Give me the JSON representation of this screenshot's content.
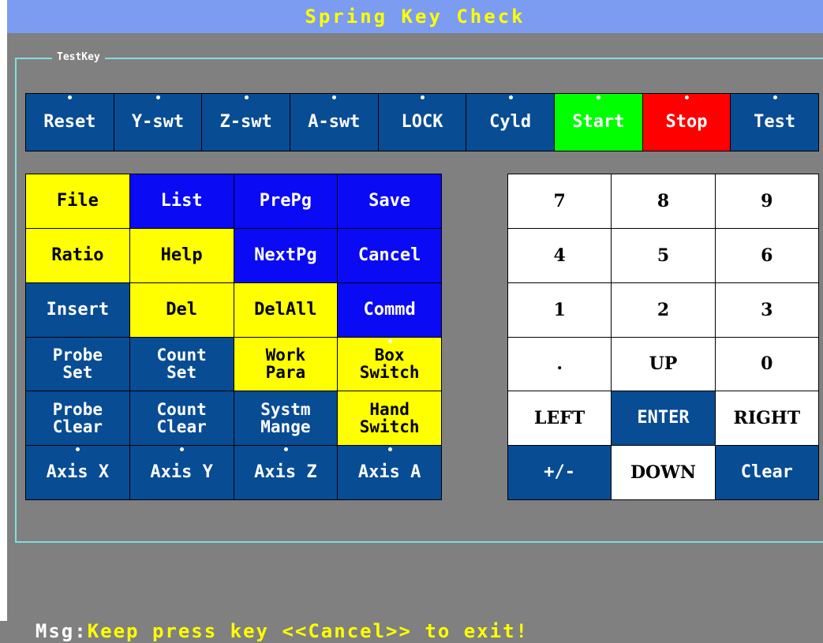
{
  "title": "Spring Key Check",
  "group_label": "TestKey",
  "colors": {
    "navy": "#084c94",
    "blue": "#0a0af5",
    "yellow": "#ffff00",
    "green": "#00ff00",
    "red": "#ff0000",
    "white": "#ffffff"
  },
  "top_row": [
    {
      "label": "Reset",
      "color": "navy",
      "indicator": true
    },
    {
      "label": "Y-swt",
      "color": "navy",
      "indicator": true
    },
    {
      "label": "Z-swt",
      "color": "navy",
      "indicator": true
    },
    {
      "label": "A-swt",
      "color": "navy",
      "indicator": true
    },
    {
      "label": "LOCK",
      "color": "navy",
      "indicator": true
    },
    {
      "label": "Cyld",
      "color": "navy",
      "indicator": true
    },
    {
      "label": "Start",
      "color": "green",
      "indicator": true
    },
    {
      "label": "Stop",
      "color": "red",
      "indicator": true
    },
    {
      "label": "Test",
      "color": "navy",
      "indicator": true
    }
  ],
  "function_grid": [
    {
      "label": "File",
      "color": "yellow"
    },
    {
      "label": "List",
      "color": "blue"
    },
    {
      "label": "PrePg",
      "color": "blue"
    },
    {
      "label": "Save",
      "color": "blue"
    },
    {
      "label": "Ratio",
      "color": "yellow"
    },
    {
      "label": "Help",
      "color": "yellow"
    },
    {
      "label": "NextPg",
      "color": "blue"
    },
    {
      "label": "Cancel",
      "color": "blue"
    },
    {
      "label": "Insert",
      "color": "navy"
    },
    {
      "label": "Del",
      "color": "yellow"
    },
    {
      "label": "DelAll",
      "color": "yellow"
    },
    {
      "label": "Commd",
      "color": "blue"
    },
    {
      "label": "Probe\nSet",
      "color": "navy"
    },
    {
      "label": "Count\nSet",
      "color": "navy"
    },
    {
      "label": "Work\nPara",
      "color": "yellow"
    },
    {
      "label": "Box\nSwitch",
      "color": "yellow",
      "indicator": true
    },
    {
      "label": "Probe\nClear",
      "color": "navy"
    },
    {
      "label": "Count\nClear",
      "color": "navy"
    },
    {
      "label": "Systm\nMange",
      "color": "navy"
    },
    {
      "label": "Hand\nSwitch",
      "color": "yellow"
    },
    {
      "label": "Axis X",
      "color": "navy",
      "indicator": true
    },
    {
      "label": "Axis Y",
      "color": "navy",
      "indicator": true
    },
    {
      "label": "Axis Z",
      "color": "navy",
      "indicator": true
    },
    {
      "label": "Axis A",
      "color": "navy",
      "indicator": true
    }
  ],
  "keypad": [
    {
      "label": "7",
      "color": "white"
    },
    {
      "label": "8",
      "color": "white"
    },
    {
      "label": "9",
      "color": "white"
    },
    {
      "label": "4",
      "color": "white"
    },
    {
      "label": "5",
      "color": "white"
    },
    {
      "label": "6",
      "color": "white"
    },
    {
      "label": "1",
      "color": "white"
    },
    {
      "label": "2",
      "color": "white"
    },
    {
      "label": "3",
      "color": "white"
    },
    {
      "label": ".",
      "color": "white"
    },
    {
      "label": "UP",
      "color": "white"
    },
    {
      "label": "0",
      "color": "white"
    },
    {
      "label": "LEFT",
      "color": "white"
    },
    {
      "label": "ENTER",
      "color": "navy"
    },
    {
      "label": "RIGHT",
      "color": "white"
    },
    {
      "label": "+/-",
      "color": "navy"
    },
    {
      "label": "DOWN",
      "color": "white"
    },
    {
      "label": "Clear",
      "color": "navy"
    }
  ],
  "message": {
    "prefix": "Msg:",
    "text": "Keep press key <<Cancel>> to exit!"
  }
}
